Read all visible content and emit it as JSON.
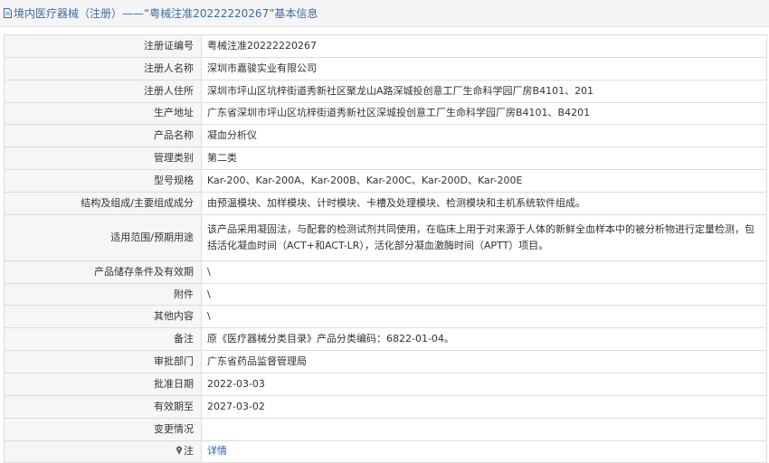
{
  "header": {
    "title": "境内医疗器械（注册）——“粤械注准20222220267”基本信息"
  },
  "rows": [
    {
      "label": "注册证编号",
      "value": "粤械注准20222220267"
    },
    {
      "label": "注册人名称",
      "value": "深圳市嘉骏实业有限公司"
    },
    {
      "label": "注册人住所",
      "value": "深圳市坪山区坑梓街道秀新社区聚龙山A路深城投创意工厂生命科学园厂房B4101、201"
    },
    {
      "label": "生产地址",
      "value": "广东省深圳市坪山区坑梓街道秀新社区深城投创意工厂生命科学园厂房B4101、B4201"
    },
    {
      "label": "产品名称",
      "value": "凝血分析仪"
    },
    {
      "label": "管理类别",
      "value": "第二类"
    },
    {
      "label": "型号规格",
      "value": "Kar-200、Kar-200A、Kar-200B、Kar-200C、Kar-200D、Kar-200E"
    },
    {
      "label": "结构及组成/主要组成成分",
      "value": "由预温模块、加样模块、计时模块、卡槽及处理模块、检测模块和主机系统软件组成。"
    },
    {
      "label": "适用范围/预期用途",
      "value": "该产品采用凝固法，与配套的检测试剂共同使用，在临床上用于对来源于人体的新鲜全血样本中的被分析物进行定量检测，包括活化凝血时间（ACT+和ACT-LR），活化部分凝血激酶时间（APTT）项目。"
    },
    {
      "label": "产品储存条件及有效期",
      "value": "\\"
    },
    {
      "label": "附件",
      "value": "\\"
    },
    {
      "label": "其他内容",
      "value": "\\"
    },
    {
      "label": "备注",
      "value": "原《医疗器械分类目录》产品分类编码：6822-01-04。"
    },
    {
      "label": "审批部门",
      "value": "广东省药品监督管理局"
    },
    {
      "label": "批准日期",
      "value": "2022-03-03"
    },
    {
      "label": "有效期至",
      "value": "2027-03-02"
    },
    {
      "label": "变更情况",
      "value": ""
    }
  ],
  "note_row": {
    "label": "注",
    "link_text": "详情"
  },
  "icons": {
    "title": "document-icon",
    "note": "pin-icon"
  },
  "colors": {
    "title": "#3d6aa5",
    "link": "#2a63b5",
    "label_bg": "#f6f6f6",
    "border": "#dcdcdc"
  }
}
